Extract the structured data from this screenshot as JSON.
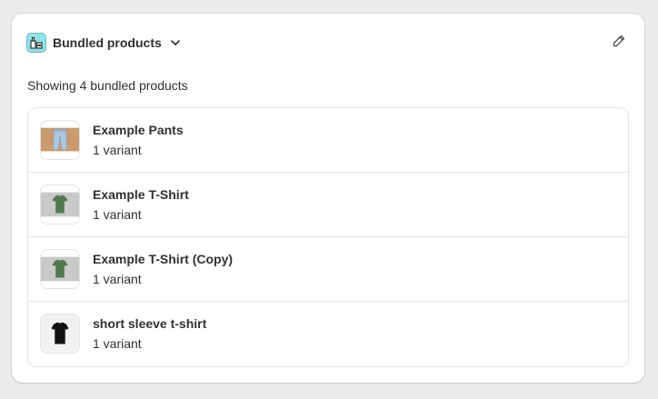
{
  "section": {
    "title": "Bundled products",
    "app_icon": "bundle-boxes-icon",
    "edit_icon": "pencil-icon",
    "summary": "Showing 4 bundled products"
  },
  "products": [
    {
      "name": "Example Pants",
      "variants": "1 variant",
      "thumb": "pants"
    },
    {
      "name": "Example T-Shirt",
      "variants": "1 variant",
      "thumb": "green-tshirt"
    },
    {
      "name": "Example T-Shirt (Copy)",
      "variants": "1 variant",
      "thumb": "green-tshirt"
    },
    {
      "name": "short sleeve t-shirt",
      "variants": "1 variant",
      "thumb": "black-tshirt"
    }
  ],
  "colors": {
    "app_icon_bg": "#8fe3e8",
    "tshirt_green": "#4f7a4f",
    "pants_bg": "#c99b6e",
    "jeans": "#a9c7df"
  }
}
